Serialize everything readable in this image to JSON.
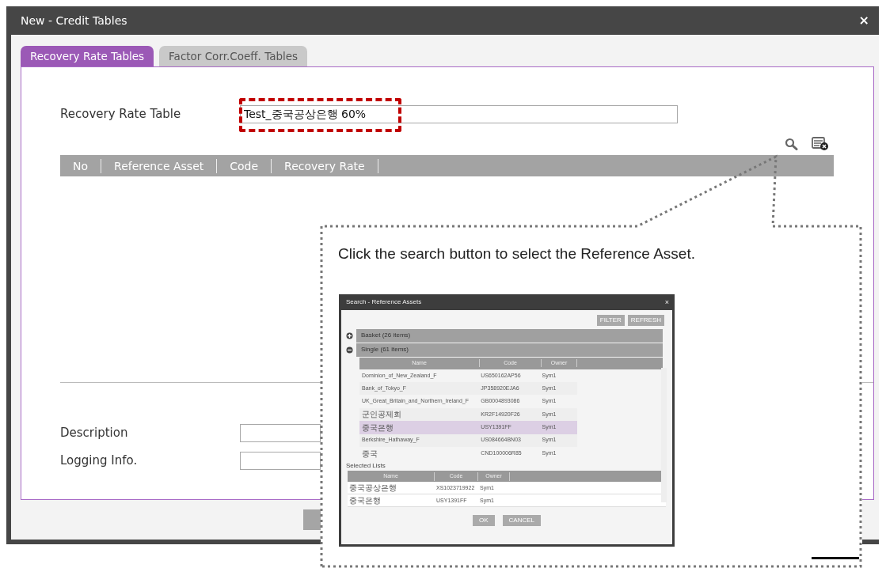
{
  "window": {
    "title": "New - Credit Tables",
    "close": "×"
  },
  "tabs": [
    {
      "label": "Recovery Rate Tables",
      "selected": true
    },
    {
      "label": "Factor Corr.Coeff. Tables",
      "selected": false
    }
  ],
  "table_name": {
    "label": "Recovery Rate Table",
    "value": "Test_중국공상은행 60%",
    "highlighted": true
  },
  "table": {
    "columns": [
      "No",
      "Reference Asset",
      "Code",
      "Recovery Rate"
    ]
  },
  "fields": [
    {
      "label": "Description"
    },
    {
      "label": "Logging Info."
    }
  ],
  "callout": {
    "text": "Click the search button to select the Reference Asset.",
    "dialog": {
      "title": "Search - Reference Assets",
      "close": "×",
      "buttons": [
        "FILTER",
        "REFRESH"
      ],
      "groups": [
        {
          "label": "Basket (26 items)",
          "expanded": false
        },
        {
          "label": "Single (61 items)",
          "expanded": true
        }
      ],
      "columns": [
        "Name",
        "Code",
        "Owner"
      ],
      "rows": [
        {
          "name": "Dominion_of_New_Zealand_F",
          "code": "US650162AP56",
          "owner": "Sym1",
          "selected": false
        },
        {
          "name": "Bank_of_Tokyo_F",
          "code": "JP358920EJA6",
          "owner": "Sym1",
          "selected": false
        },
        {
          "name": "UK_Great_Britain_and_Northern_Ireland_F",
          "code": "GB0004893086",
          "owner": "Sym1",
          "selected": false
        },
        {
          "name": "군인공제회",
          "code": "KR2F14920F26",
          "owner": "Sym1",
          "selected": false
        },
        {
          "name": "중국은행",
          "code": "USY1391FF",
          "owner": "Sym1",
          "selected": true
        },
        {
          "name": "Berkshire_Hathaway_F",
          "code": "US084664BN03",
          "owner": "Sym1",
          "selected": false
        },
        {
          "name": "중국",
          "code": "CND100006R85",
          "owner": "Sym1",
          "selected": false
        }
      ],
      "selected_title": "Selected Lists",
      "selected_columns": [
        "Name",
        "Code",
        "Owner"
      ],
      "selected_rows": [
        {
          "name": "중국공상은행",
          "code": "XS1023719922",
          "owner": "Sym1"
        },
        {
          "name": "중국은행",
          "code": "USY1391FF",
          "owner": "Sym1"
        }
      ],
      "footer_buttons": [
        "OK",
        "CANCEL"
      ]
    }
  }
}
